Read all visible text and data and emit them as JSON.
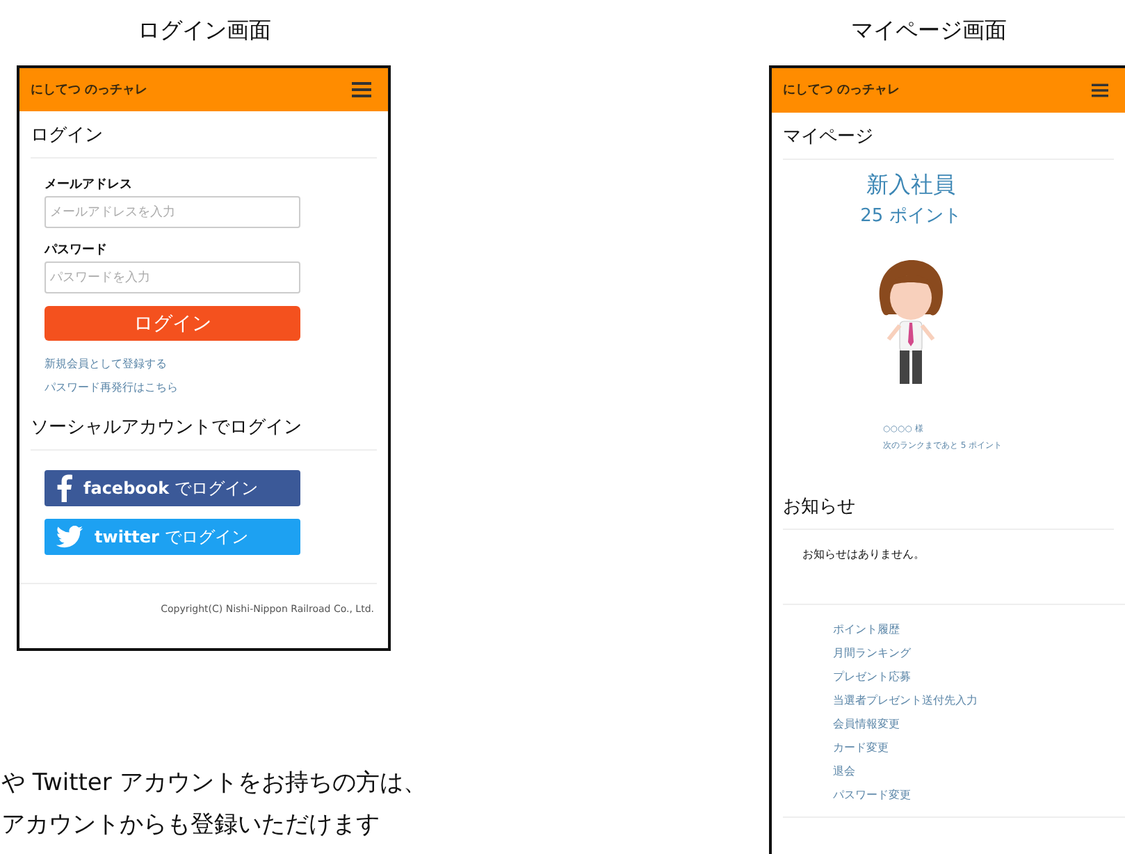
{
  "login_screen": {
    "caption": "ログイン画面",
    "app_bar": {
      "title": "にしてつ のっチャレ"
    },
    "heading": "ログイン",
    "fields": [
      {
        "label": "メールアドレス",
        "placeholder": "メールアドレスを入力"
      },
      {
        "label": "パスワード",
        "placeholder": "パスワードを入力"
      }
    ],
    "login_button": "ログイン",
    "links": [
      "新規会員として登録する",
      "パスワード再発行はこちら"
    ],
    "social_heading": "ソーシャルアカウントでログイン",
    "social_buttons": [
      {
        "kind": "facebook",
        "label": "**facebook** でログイン"
      },
      {
        "kind": "twitter",
        "label": "**twitter** でログイン"
      }
    ],
    "copyright": "Copyright(C) Nishi-Nippon Railroad Co., Ltd."
  },
  "mypage_screen": {
    "caption": "マイページ画面",
    "app_bar": {
      "title": "にしてつ のっチャレ"
    },
    "heading": "マイページ",
    "rank": "新入社員",
    "points": "25 ポイント",
    "user_name": "○○○○ 様",
    "next_rank": "次のランクまであと 5 ポイント",
    "news_heading": "お知らせ",
    "news_message": "お知らせはありません。",
    "menu": [
      "ポイント履歴",
      "月間ランキング",
      "プレゼント応募",
      "当選者プレゼント送付先入力",
      "会員情報変更",
      "カード変更",
      "退会",
      "パスワード変更"
    ]
  },
  "note_lines": [
    "や Twitter アカウントをお持ちの方は、",
    "アカウントからも登録いただけます"
  ]
}
